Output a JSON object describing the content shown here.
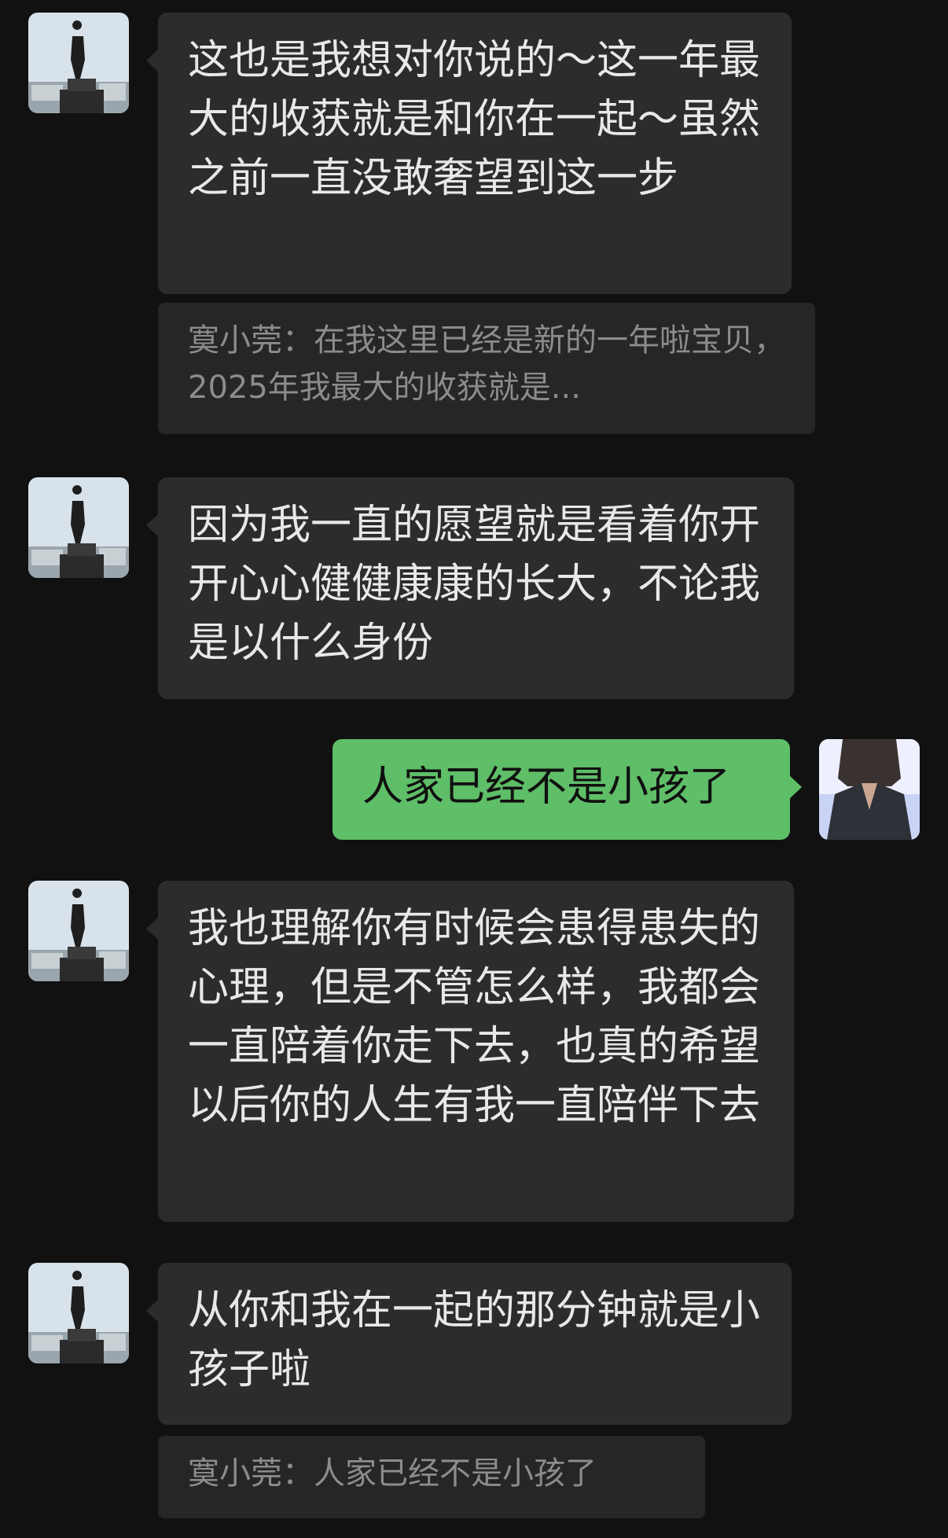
{
  "messages": [
    {
      "sender": "other",
      "text": "这也是我想对你说的～这一年最大的收获就是和你在一起～虽然之前一直没敢奢望到这一步"
    },
    {
      "sender": "other",
      "text": "因为我一直的愿望就是看着你开开心心健健康康的长大，不论我是以什么身份"
    },
    {
      "sender": "self",
      "text": "人家已经不是小孩了"
    },
    {
      "sender": "other",
      "text": "我也理解你有时候会患得患失的心理，但是不管怎么样，我都会一直陪着你走下去，也真的希望以后你的人生有我一直陪伴下去"
    },
    {
      "sender": "other",
      "text": "从你和我在一起的那分钟就是小孩子啦"
    }
  ],
  "quotes": [
    {
      "text": "寞小莞：在我这里已经是新的一年啦宝贝，2025年我最大的收获就是..."
    },
    {
      "text": "寞小莞：人家已经不是小孩了"
    }
  ],
  "colors": {
    "background": "#111111",
    "incoming_bubble": "#2c2c2c",
    "outgoing_bubble": "#5fbe68",
    "quote_background": "#262626"
  }
}
